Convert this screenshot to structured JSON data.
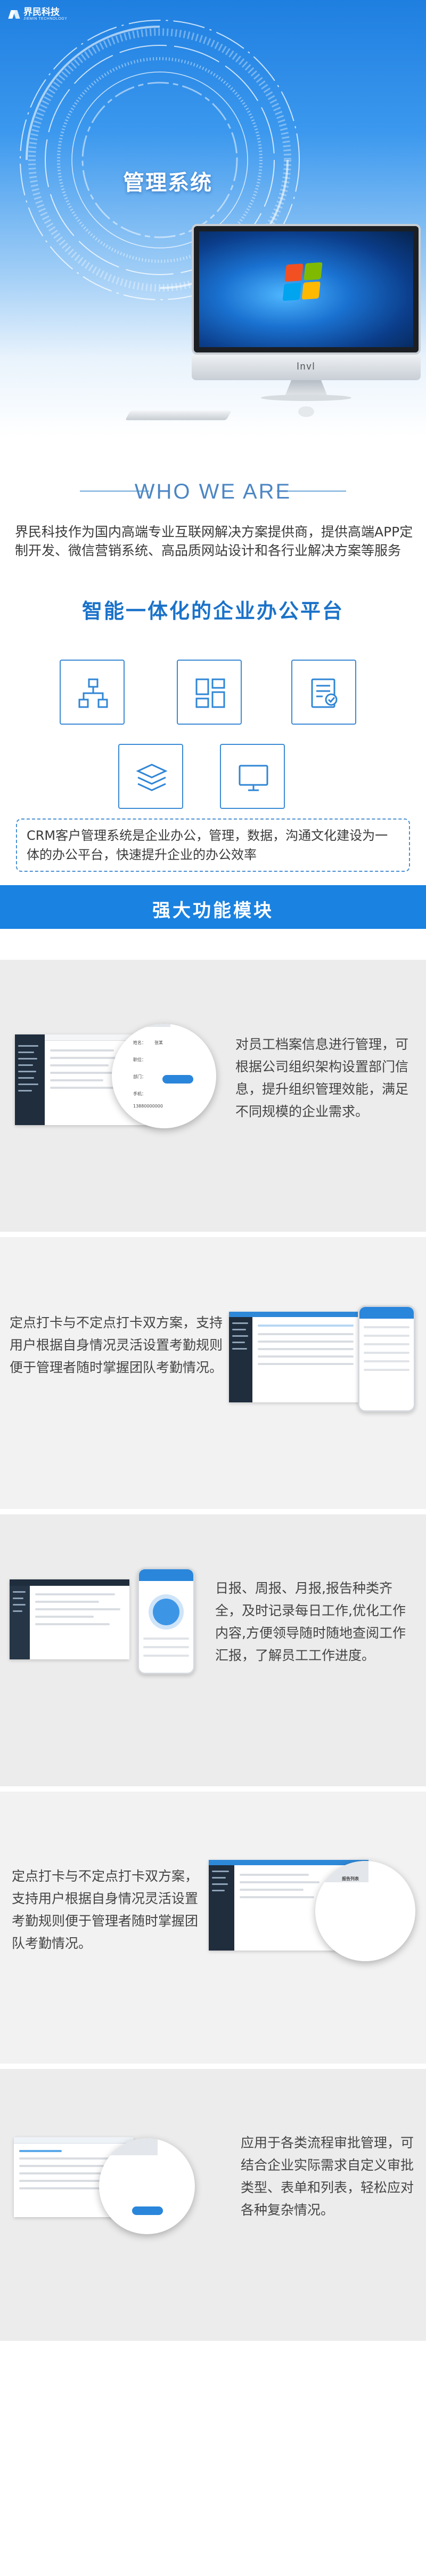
{
  "brand": {
    "name": "界民科技",
    "sub": "JIEMIN TECHNOLOGY"
  },
  "hero": {
    "title": "管理系统",
    "monitor_label": "lnvl"
  },
  "who": {
    "heading": "WHO WE ARE",
    "about": "界民科技作为国内高端专业互联网解决方案提供商，提供高端APP定制开发、微信营销系统、高品质网站设计和各行业解决方案等服务"
  },
  "platform": {
    "title": "智能一体化的企业办公平台"
  },
  "icons": [
    {
      "name": "org-chart-icon"
    },
    {
      "name": "dashboard-grid-icon"
    },
    {
      "name": "checklist-icon"
    },
    {
      "name": "layers-icon"
    },
    {
      "name": "monitor-icon"
    }
  ],
  "crm": {
    "text": "CRM客户管理系统是企业办公，管理，数据，沟通文化建设为一体的办公平台，快速提升企业的办公效率"
  },
  "functions": {
    "title": "强大功能模块"
  },
  "features": [
    {
      "text": "对员工档案信息进行管理，可根据公司组织架构设置部门信息，提升组织管理效能，满足不同规模的企业需求。",
      "popup": {
        "field1": "姓名：",
        "val1": "张某",
        "field2": "职位：",
        "field3": "部门：",
        "field4": "手机：",
        "phone": "13880000000"
      }
    },
    {
      "text": "定点打卡与不定点打卡双方案，支持用户根据自身情况灵活设置考勤规则便于管理者随时掌握团队考勤情况。"
    },
    {
      "text": "日报、周报、月报,报告种类齐全，及时记录每日工作,优化工作内容,方便领导随时随地查阅工作汇报，了解员工工作进度。"
    },
    {
      "text": "定点打卡与不定点打卡双方案，支持用户根据自身情况灵活设置考勤规则便于管理者随时掌握团队考勤情况。",
      "popup": {
        "title": "报告列表"
      }
    },
    {
      "text": "应用于各类流程审批管理，可结合企业实际需求自定义审批类型、表单和列表，轻松应对各种复杂情况。"
    }
  ]
}
